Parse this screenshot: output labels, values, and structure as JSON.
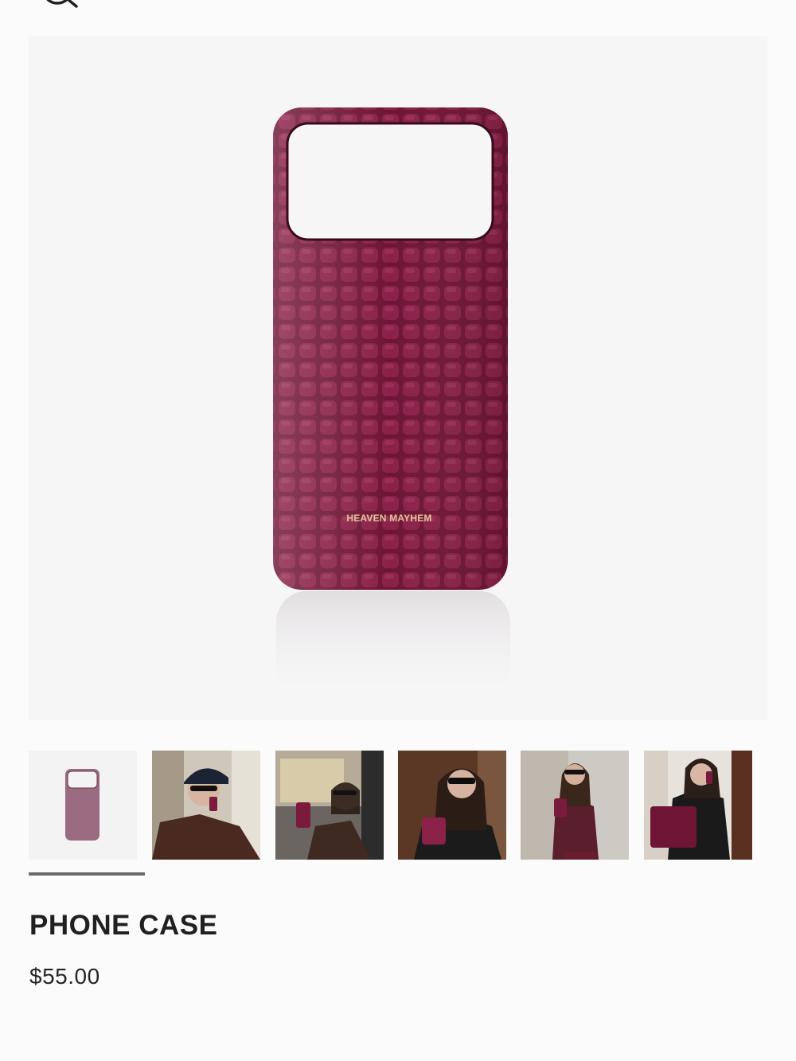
{
  "header": {
    "search_icon": "search-icon"
  },
  "product": {
    "brand_imprint": "HEAVEN MAYHEM",
    "title": "PHONE CASE",
    "price": "$55.00",
    "color": "#7a1a3d"
  },
  "gallery": {
    "thumbnails": [
      {
        "label": "case-product-shot",
        "active": true
      },
      {
        "label": "model-in-cap-with-phone",
        "active": false
      },
      {
        "label": "model-in-car-with-phone",
        "active": false
      },
      {
        "label": "model-selfie-in-leather-jacket",
        "active": false
      },
      {
        "label": "model-in-burgundy-suit",
        "active": false
      },
      {
        "label": "model-on-phone-seated",
        "active": false
      }
    ]
  }
}
